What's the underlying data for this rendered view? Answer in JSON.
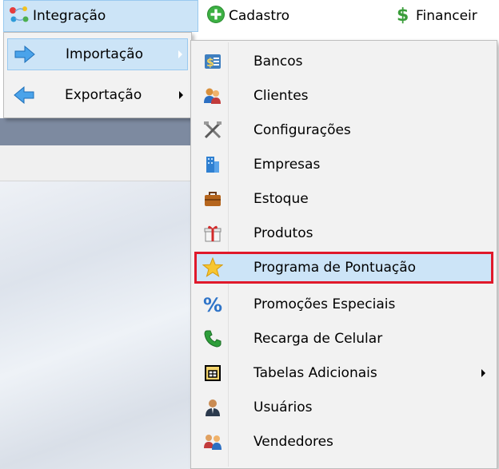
{
  "menubar": {
    "integracao": "Integração",
    "cadastro": "Cadastro",
    "financeiro": "Financeir"
  },
  "integracao_menu": {
    "items": [
      {
        "label": "Importação",
        "icon": "arrow-right-icon",
        "has_submenu": true,
        "highlighted": true
      },
      {
        "label": "Exportação",
        "icon": "arrow-left-icon",
        "has_submenu": true,
        "highlighted": false
      }
    ]
  },
  "importacao_menu": {
    "items": [
      {
        "label": "Bancos",
        "icon": "bank-icon"
      },
      {
        "label": "Clientes",
        "icon": "clients-icon"
      },
      {
        "label": "Configurações",
        "icon": "tools-icon"
      },
      {
        "label": "Empresas",
        "icon": "building-icon"
      },
      {
        "label": "Estoque",
        "icon": "briefcase-icon"
      },
      {
        "label": "Produtos",
        "icon": "gift-icon"
      },
      {
        "label": "Programa de Pontuação",
        "icon": "star-icon",
        "selected": true
      },
      {
        "label": "Promoções Especiais",
        "icon": "percent-icon"
      },
      {
        "label": "Recarga de Celular",
        "icon": "phone-icon"
      },
      {
        "label": "Tabelas Adicionais",
        "icon": "table-icon",
        "has_submenu": true
      },
      {
        "label": "Usuários",
        "icon": "user-icon"
      },
      {
        "label": "Vendedores",
        "icon": "sellers-icon"
      }
    ]
  },
  "colors": {
    "highlight": "#cce4f7",
    "highlight_border": "#99c9ef",
    "selection_outline": "#e0192b",
    "menu_bg": "#f2f2f2"
  }
}
